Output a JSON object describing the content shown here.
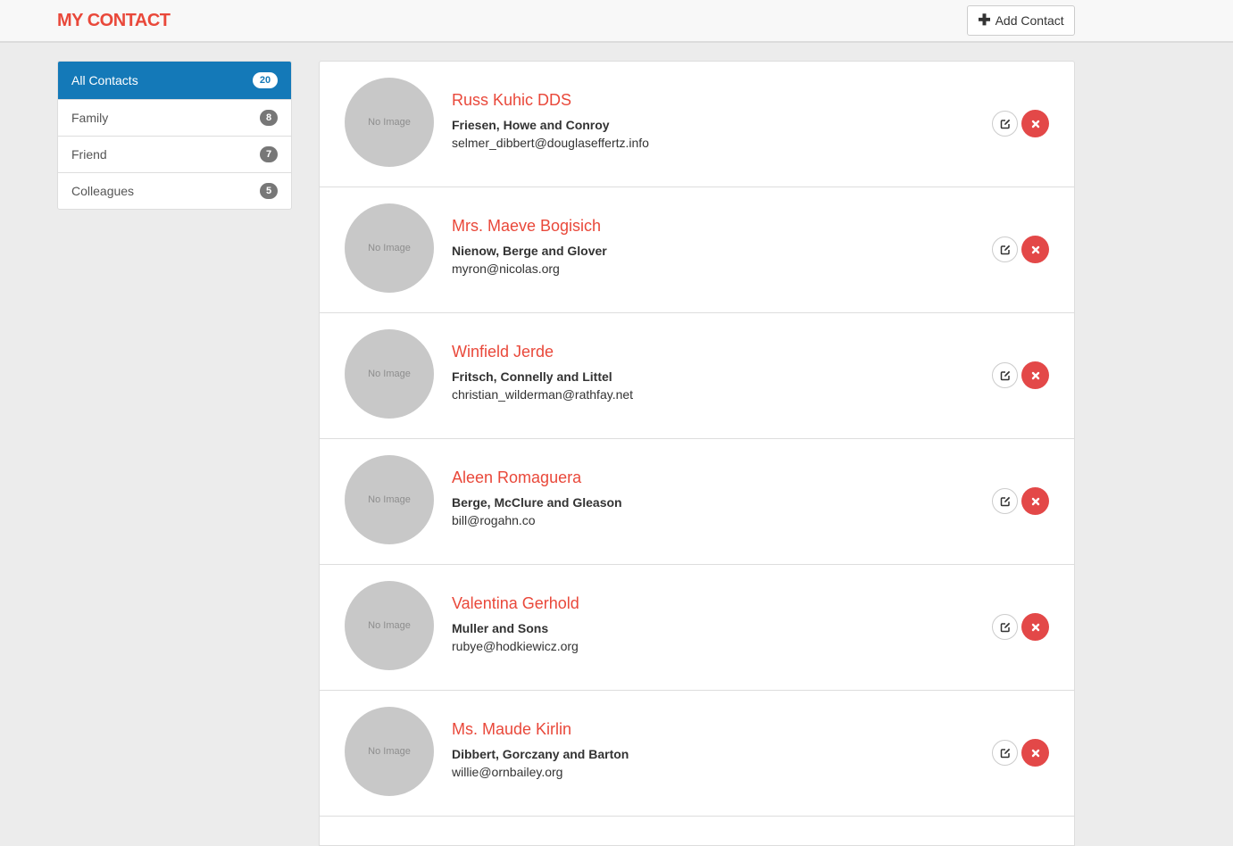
{
  "header": {
    "brand": "MY CONTACT",
    "add_button_label": "Add Contact"
  },
  "sidebar": {
    "groups": [
      {
        "label": "All Contacts",
        "count": "20",
        "active": true
      },
      {
        "label": "Family",
        "count": "8",
        "active": false
      },
      {
        "label": "Friend",
        "count": "7",
        "active": false
      },
      {
        "label": "Colleagues",
        "count": "5",
        "active": false
      }
    ]
  },
  "contacts": [
    {
      "avatar_text": "No Image",
      "name": "Russ Kuhic DDS",
      "company": "Friesen, Howe and Conroy",
      "email": "selmer_dibbert@douglaseffertz.info"
    },
    {
      "avatar_text": "No Image",
      "name": "Mrs. Maeve Bogisich",
      "company": "Nienow, Berge and Glover",
      "email": "myron@nicolas.org"
    },
    {
      "avatar_text": "No Image",
      "name": "Winfield Jerde",
      "company": "Fritsch, Connelly and Littel",
      "email": "christian_wilderman@rathfay.net"
    },
    {
      "avatar_text": "No Image",
      "name": "Aleen Romaguera",
      "company": "Berge, McClure and Gleason",
      "email": "bill@rogahn.co"
    },
    {
      "avatar_text": "No Image",
      "name": "Valentina Gerhold",
      "company": "Muller and Sons",
      "email": "rubye@hodkiewicz.org"
    },
    {
      "avatar_text": "No Image",
      "name": "Ms. Maude Kirlin",
      "company": "Dibbert, Gorczany and Barton",
      "email": "willie@ornbailey.org"
    }
  ],
  "icons": {
    "add": "plus-icon",
    "edit": "edit-icon",
    "delete": "close-icon"
  },
  "colors": {
    "brand": "#e9483a",
    "active_group": "#1479b8",
    "delete_button": "#e34848",
    "avatar_placeholder": "#c8c8c8"
  }
}
